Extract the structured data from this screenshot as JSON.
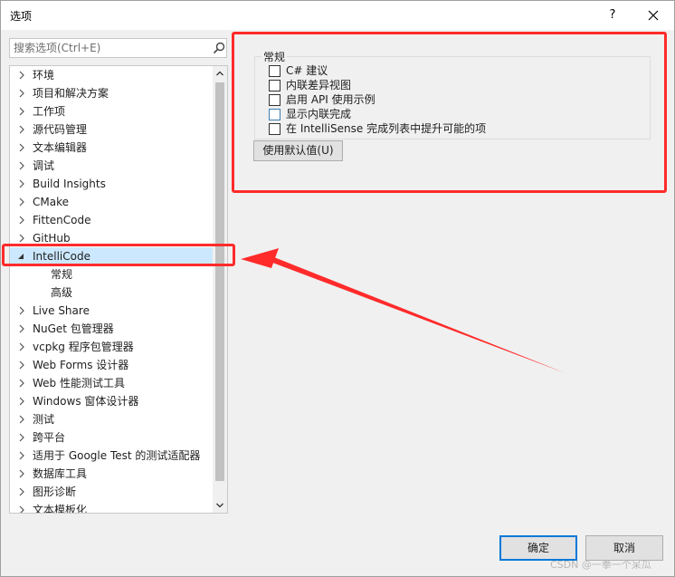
{
  "window": {
    "title": "选项",
    "help_label": "?",
    "close_icon": "close-icon"
  },
  "search": {
    "placeholder": "搜索选项(Ctrl+E)",
    "icon": "search-icon"
  },
  "tree": {
    "items": [
      {
        "label": "环境",
        "state": "collapsed"
      },
      {
        "label": "项目和解决方案",
        "state": "collapsed"
      },
      {
        "label": "工作项",
        "state": "collapsed"
      },
      {
        "label": "源代码管理",
        "state": "collapsed"
      },
      {
        "label": "文本编辑器",
        "state": "collapsed"
      },
      {
        "label": "调试",
        "state": "collapsed"
      },
      {
        "label": "Build Insights",
        "state": "collapsed"
      },
      {
        "label": "CMake",
        "state": "collapsed"
      },
      {
        "label": "FittenCode",
        "state": "collapsed"
      },
      {
        "label": "GitHub",
        "state": "collapsed"
      },
      {
        "label": "IntelliCode",
        "state": "expanded",
        "selected": true
      },
      {
        "label": "常规",
        "state": "child"
      },
      {
        "label": "高级",
        "state": "child"
      },
      {
        "label": "Live Share",
        "state": "collapsed"
      },
      {
        "label": "NuGet 包管理器",
        "state": "collapsed"
      },
      {
        "label": "vcpkg 程序包管理器",
        "state": "collapsed"
      },
      {
        "label": "Web Forms 设计器",
        "state": "collapsed"
      },
      {
        "label": "Web 性能测试工具",
        "state": "collapsed"
      },
      {
        "label": "Windows 窗体设计器",
        "state": "collapsed"
      },
      {
        "label": "测试",
        "state": "collapsed"
      },
      {
        "label": "跨平台",
        "state": "collapsed"
      },
      {
        "label": "适用于 Google Test 的测试适配器",
        "state": "collapsed"
      },
      {
        "label": "数据库工具",
        "state": "collapsed"
      },
      {
        "label": "图形诊断",
        "state": "collapsed"
      },
      {
        "label": "文本模板化",
        "state": "collapsed"
      }
    ]
  },
  "settings": {
    "group_title": "常规",
    "options": [
      {
        "label": "C# 建议",
        "checked": false
      },
      {
        "label": "内联差异视图",
        "checked": false
      },
      {
        "label": "启用 API 使用示例",
        "checked": false
      },
      {
        "label": "显示内联完成",
        "checked": false
      },
      {
        "label": "在 IntelliSense 完成列表中提升可能的项",
        "checked": false
      }
    ],
    "reset_label": "使用默认值(U)"
  },
  "footer": {
    "ok_label": "确定",
    "cancel_label": "取消"
  },
  "watermark": "CSDN @一拳一个呆瓜",
  "colors": {
    "annotation": "#ff2b2b",
    "selection": "#cce8ff",
    "accent": "#0078d7"
  }
}
